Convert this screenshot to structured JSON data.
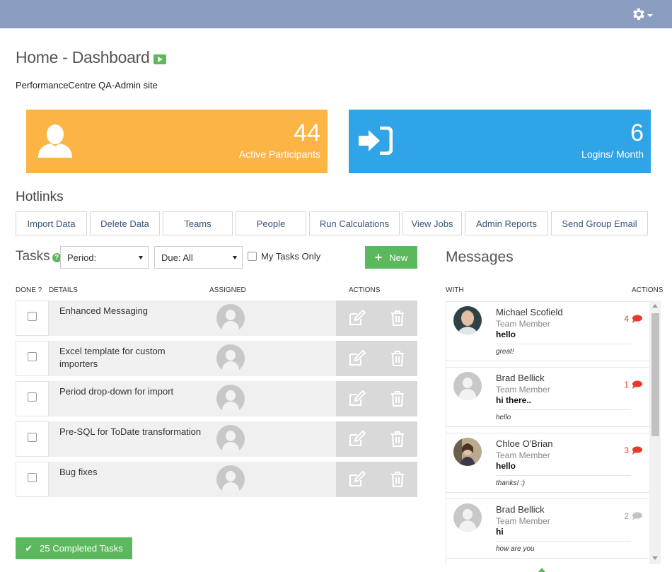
{
  "header": {
    "settings_icon": "gear-icon"
  },
  "page": {
    "title": "Home - Dashboard",
    "title_icon": "play-icon",
    "site_name": "PerformanceCentre QA-Admin site"
  },
  "stats": [
    {
      "value": "44",
      "label": "Active Participants",
      "icon": "user-icon",
      "color": "#fcb545"
    },
    {
      "value": "6",
      "label": "Logins/ Month",
      "icon": "sign-in-icon",
      "color": "#2fa4e7"
    }
  ],
  "hotlinks": {
    "title": "Hotlinks",
    "items": [
      "Import Data",
      "Delete Data",
      "Teams",
      "People",
      "Run Calculations",
      "View Jobs",
      "Admin Reports",
      "Send Group Email"
    ]
  },
  "tasks": {
    "title": "Tasks",
    "period_select": "Period:",
    "due_select": "Due: All",
    "my_tasks_label": "My Tasks Only",
    "new_label": "New",
    "columns": {
      "done": "DONE ?",
      "details": "DETAILS",
      "assigned": "ASSIGNED",
      "actions": "ACTIONS"
    },
    "items": [
      {
        "details": "Enhanced Messaging"
      },
      {
        "details": "Excel template for custom importers"
      },
      {
        "details": "Period drop-down for import"
      },
      {
        "details": "Pre-SQL for ToDate transformation"
      },
      {
        "details": "Bug fixes"
      }
    ],
    "completed_label": "25 Completed Tasks"
  },
  "messages": {
    "title": "Messages",
    "columns": {
      "with": "WITH",
      "actions": "ACTIONS"
    },
    "items": [
      {
        "name": "Michael Scofield",
        "role": "Team Member",
        "subject": "hello",
        "preview": "great!",
        "count": "4",
        "unread": true
      },
      {
        "name": "Brad Bellick",
        "role": "Team Member",
        "subject": "hi there..",
        "preview": "hello",
        "count": "1",
        "unread": true
      },
      {
        "name": "Chloe O'Brian",
        "role": "Team Member",
        "subject": "hello",
        "preview": "thanks! :)",
        "count": "3",
        "unread": true
      },
      {
        "name": "Brad Bellick",
        "role": "Team Member",
        "subject": "hi",
        "preview": "how are you",
        "count": "2",
        "unread": false
      }
    ]
  },
  "colors": {
    "accent_green": "#5cb85c",
    "unread_red": "#e8392b",
    "topbar": "#8c9dc2"
  }
}
